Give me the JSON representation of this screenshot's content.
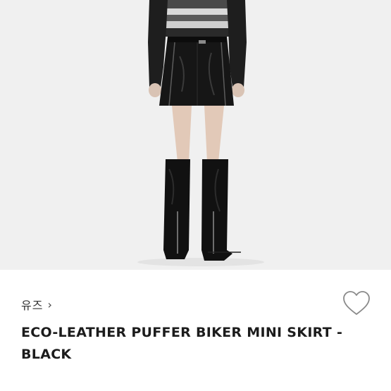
{
  "product": {
    "image_alt": "Eco-leather puffer biker mini skirt worn with striped knit sweater and black knee-high boots",
    "brand": "유즈",
    "brand_chevron": "›",
    "title": "ECO-LEATHER PUFFER BIKER MINI SKIRT - BLACK"
  },
  "icons": {
    "wishlist": "heart-outline-icon",
    "brand_arrow": "chevron-right-icon"
  },
  "colors": {
    "background": "#ffffff",
    "photo_background": "#f0f0f0",
    "title_text": "#1c1c1c",
    "brand_text": "#333333",
    "heart_stroke": "#8a8a8a"
  }
}
